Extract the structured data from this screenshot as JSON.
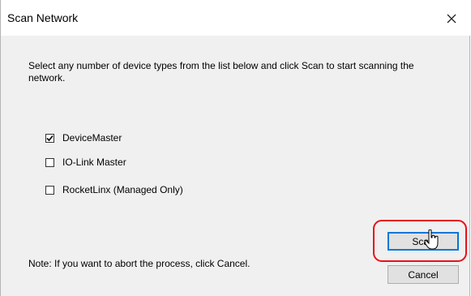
{
  "window": {
    "title": "Scan Network",
    "close_icon": "close-icon"
  },
  "instructions": "Select any number of device types from the list below and click Scan to start scanning the network.",
  "device_types": [
    {
      "label": "DeviceMaster",
      "checked": true
    },
    {
      "label": "IO-Link Master",
      "checked": false
    },
    {
      "label": "RocketLinx (Managed Only)",
      "checked": false
    }
  ],
  "note": "Note: If you want to abort the process, click Cancel.",
  "buttons": {
    "scan_label": "Scan",
    "cancel_label": "Cancel"
  },
  "colors": {
    "highlight": "#e8101a",
    "focus_border": "#0078d7"
  }
}
